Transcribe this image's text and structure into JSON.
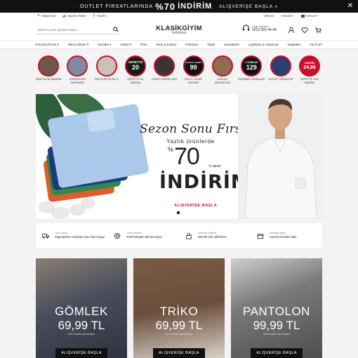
{
  "topbar": {
    "text1": "OUTLET FIRSATLARINDA",
    "pct": "%70",
    "text2": "İNDİRİM",
    "cta": "ALIŞVERİŞE BAŞLA »",
    "close": "✕"
  },
  "util": {
    "left": [
      "Mağazalar",
      "Sipariş Takibi",
      "Yardım"
    ],
    "right": [
      "İletişim",
      "Hesabım",
      "Türkçe ▾"
    ]
  },
  "header": {
    "search_placeholder": "Binlerce ürün içinden arayın...",
    "logo_main": "KLASİKGİYİM",
    "logo_sub": "Fabrikası",
    "phone_label": "Çağrı Merkezi",
    "phone_number": "0212 555 44 44"
  },
  "nav": [
    "KOLEKSİYON ▾",
    "Takım Elbise ▾",
    "Gömlek ▾",
    "Ceket ▾",
    "Triko",
    "Mont & Kaban",
    "Pantolon",
    "Tişört",
    "Sweatshirt",
    "Ayakkabı & Aksesuar",
    "Kaşkeller",
    "OUTLET"
  ],
  "categories": [
    {
      "label": "PANTOLON İNDİRİM",
      "badge": "",
      "big": "",
      "color": "#6b5a4c"
    },
    {
      "label": "GÖMLEKLER İNDİRİMDE",
      "badge": "",
      "big": "",
      "color": "#7d8aa3"
    },
    {
      "label": "TRIKOLAR 69,99 TL",
      "badge": "",
      "big": "",
      "color": "#c9c2b5"
    },
    {
      "label": "SEPETTE EK İNDİRİM",
      "badge": "SEPETTE",
      "big": "20",
      "color": "#1a1a1a"
    },
    {
      "label": "CEKET MODELLERİ",
      "badge": "",
      "big": "",
      "color": "#3a3436"
    },
    {
      "label": "POLO T-SHIRT İNDİRİM",
      "badge": "2 POLO 1 SHIRT",
      "big": "99",
      "color": "#111"
    },
    {
      "label": "CASUAL SEVENLERE",
      "badge": "",
      "big": "",
      "color": "#8c6e4e"
    },
    {
      "label": "İNDİRİMLİ HIRKALAR",
      "badge": "2 GÖMLEK",
      "big": "129",
      "color": "#111"
    },
    {
      "label": "OUTLET ÜRÜNLERİ",
      "badge": "",
      "big": "",
      "color": "#2c3e70"
    },
    {
      "label": "SEPETTE %20 İNDİRİM",
      "badge": "İNDİRİM",
      "big": "24,99",
      "color": "#c8102e"
    }
  ],
  "hero": {
    "title": "Sezon Sonu Fırsatı",
    "subtitle": "Yazlık ürünlerde",
    "pct_sign": "%",
    "pct": "70",
    "pct_suffix": "'e varan",
    "indirim": "İNDİRİM",
    "cta": "ALIŞVERİŞE BAŞLA"
  },
  "features": [
    {
      "t1": "Hızlı Kargo",
      "t2": "Siparişinizin Ardından Aynı Gün Kargo"
    },
    {
      "t1": "Canlı Destek",
      "t2": "%100 Müşteri Memnuniyeti"
    },
    {
      "t1": "Güvenli Ödeme",
      "t2": "256 Bit SSL Şifreleme"
    },
    {
      "t1": "Ücretsiz İade",
      "t2": "Aynıda Ücretsiz İade"
    }
  ],
  "promos": [
    {
      "title": "GÖMLEK",
      "price": "69,99 TL",
      "sub": "tüm fırsatlar için tıklayın",
      "cta": "ALIŞVERİŞE BAŞLA",
      "bg": "#4a4e5c"
    },
    {
      "title": "TRİKO",
      "price": "69,99 TL",
      "sub": "tüm fırsatlar için tıklayın",
      "cta": "ALIŞVERİŞE BAŞLA",
      "bg": "#6b4e3c"
    },
    {
      "title": "PANTOLON",
      "price": "99,99 TL",
      "sub": "tüm fırsatlar için tıklayın",
      "cta": "ALIŞVERİŞE BAŞLA",
      "bg": "#5a5a5a"
    }
  ],
  "colors": {
    "accent": "#c8102e",
    "dark": "#111111"
  }
}
